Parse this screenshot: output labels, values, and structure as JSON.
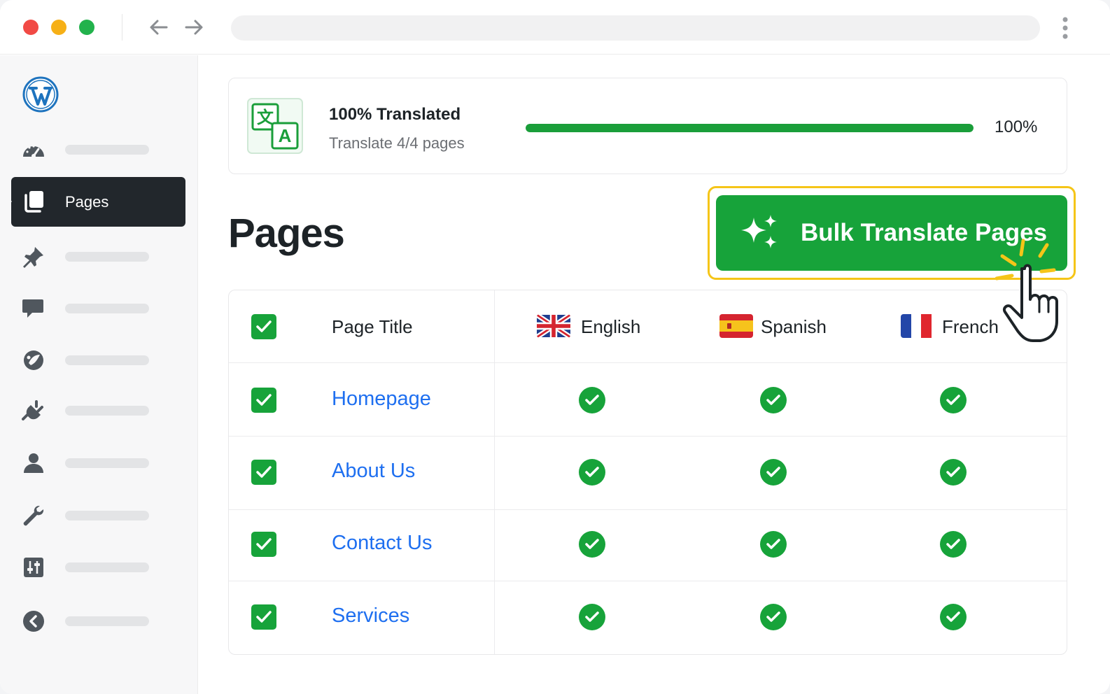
{
  "sidebar": {
    "active_label": "Pages"
  },
  "progress": {
    "title": "100% Translated",
    "subtitle": "Translate 4/4 pages",
    "percent_label": "100%",
    "percent_value": 100
  },
  "main": {
    "title": "Pages",
    "bulk_button_label": "Bulk Translate Pages"
  },
  "table": {
    "headers": {
      "title": "Page Title",
      "languages": [
        "English",
        "Spanish",
        "French"
      ]
    },
    "rows": [
      {
        "title": "Homepage",
        "english": true,
        "spanish": true,
        "french": true
      },
      {
        "title": "About Us",
        "english": true,
        "spanish": true,
        "french": true
      },
      {
        "title": "Contact Us",
        "english": true,
        "spanish": true,
        "french": true
      },
      {
        "title": "Services",
        "english": true,
        "spanish": true,
        "french": true
      }
    ]
  },
  "colors": {
    "accent_green": "#17a33a",
    "link_blue": "#1e6ff0",
    "highlight_yellow": "#f5c518",
    "sidebar_active": "#22272c"
  },
  "icons": {
    "sidebar": [
      "wordpress-logo-icon",
      "dashboard-icon",
      "pages-icon",
      "pin-icon",
      "comment-icon",
      "appearance-icon",
      "plugin-icon",
      "user-icon",
      "tools-icon",
      "settings-icon",
      "collapse-icon"
    ],
    "progress": "translate-icon",
    "bulk": "sparkles-icon"
  }
}
